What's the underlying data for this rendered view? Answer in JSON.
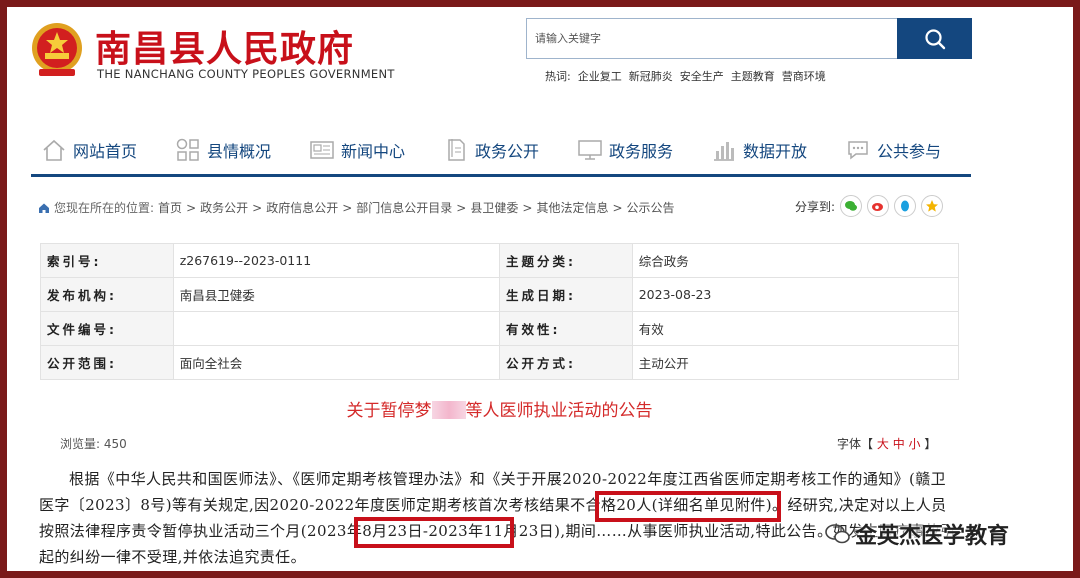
{
  "header": {
    "title": "南昌县人民政府",
    "subtitle": "THE NANCHANG COUNTY PEOPLES GOVERNMENT",
    "search_placeholder": "请输入关键字",
    "hot_label": "热词:",
    "hot_words": [
      "企业复工",
      "新冠肺炎",
      "安全生产",
      "主题教育",
      "营商环境"
    ]
  },
  "nav": {
    "items": [
      {
        "label": "网站首页",
        "icon": "home-icon"
      },
      {
        "label": "县情概况",
        "icon": "grid-icon"
      },
      {
        "label": "新闻中心",
        "icon": "news-icon"
      },
      {
        "label": "政务公开",
        "icon": "document-icon"
      },
      {
        "label": "政务服务",
        "icon": "monitor-icon"
      },
      {
        "label": "数据开放",
        "icon": "bar-chart-icon"
      },
      {
        "label": "公共参与",
        "icon": "chat-icon"
      }
    ]
  },
  "breadcrumb": {
    "prefix": "您现在所在的位置:",
    "items": [
      "首页",
      "政务公开",
      "政府信息公开",
      "部门信息公开目录",
      "县卫健委",
      "其他法定信息",
      "公示公告"
    ],
    "share_label": "分享到:"
  },
  "info": {
    "rows": [
      [
        "索引号:",
        "z267619--2023-0111",
        "主题分类:",
        "综合政务"
      ],
      [
        "发布机构:",
        "南昌县卫健委",
        "生成日期:",
        "2023-08-23"
      ],
      [
        "文件编号:",
        "",
        "有效性:",
        "有效"
      ],
      [
        "公开范围:",
        "面向全社会",
        "公开方式:",
        "主动公开"
      ]
    ]
  },
  "article": {
    "title_a": "关于暂停梦",
    "title_b": "等人医师执业活动的公告",
    "views": "浏览量: 450",
    "font_label": "字体【",
    "font_large": "大",
    "font_mid": "中",
    "font_small": "小",
    "font_close": "】",
    "paragraph": "根据《中华人民共和国医师法》、《医师定期考核管理办法》和《关于开展2020-2022年度江西省医师定期考核工作的通知》(赣卫医字〔2023〕8号)等有关规定,因2020-2022年度医师定期考核首次考核结果不合格20人(详细名单见附件)。经研究,决定对以上人员按照法律程序责令暂停执业活动三个月(2023年8月23日-2023年11月23日),期间……从事医师执业活动,特此公告。如发生医疗事故引起的纠纷一律不受理,并依法追究责任。"
  },
  "watermark": "金英杰医学教育",
  "colors": {
    "brand_red": "#c8101a",
    "nav_blue": "#14477f",
    "frame": "#7a1a1a"
  }
}
